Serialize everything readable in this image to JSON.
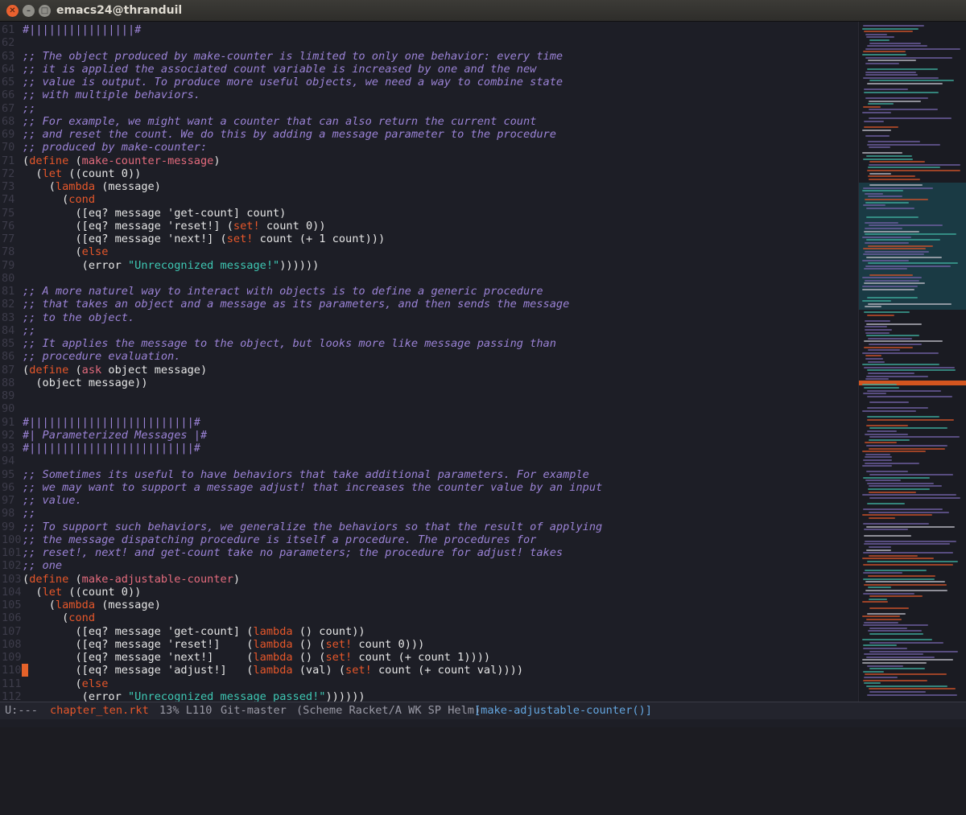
{
  "window": {
    "title": "emacs24@thranduil",
    "buttons": {
      "close": "✕",
      "minimize": "–",
      "maximize": "□"
    }
  },
  "editor": {
    "lines": [
      {
        "n": "61",
        "segs": [
          {
            "t": "#||||||||||||||||#",
            "c": "c"
          }
        ]
      },
      {
        "n": "62",
        "segs": []
      },
      {
        "n": "63",
        "segs": [
          {
            "t": ";; The object produced by make-counter is limited to only one behavior: every time",
            "c": "c"
          }
        ]
      },
      {
        "n": "64",
        "segs": [
          {
            "t": ";; it is applied the associated count variable is increased by one and the new",
            "c": "c"
          }
        ]
      },
      {
        "n": "65",
        "segs": [
          {
            "t": ";; value is output. To produce more useful objects, we need a way to combine state",
            "c": "c"
          }
        ]
      },
      {
        "n": "66",
        "segs": [
          {
            "t": ";; with multiple behaviors.",
            "c": "c"
          }
        ]
      },
      {
        "n": "67",
        "segs": [
          {
            "t": ";;",
            "c": "c"
          }
        ]
      },
      {
        "n": "68",
        "segs": [
          {
            "t": ";; For example, we might want a counter that can also return the current count",
            "c": "c"
          }
        ]
      },
      {
        "n": "69",
        "segs": [
          {
            "t": ";; and reset the count. We do this by adding a message parameter to the procedure",
            "c": "c"
          }
        ]
      },
      {
        "n": "70",
        "segs": [
          {
            "t": ";; produced by make-counter:",
            "c": "c"
          }
        ]
      },
      {
        "n": "71",
        "segs": [
          {
            "t": "(",
            "c": ""
          },
          {
            "t": "define",
            "c": "k"
          },
          {
            "t": " (",
            "c": ""
          },
          {
            "t": "make-counter-message",
            "c": "f"
          },
          {
            "t": ")",
            "c": ""
          }
        ]
      },
      {
        "n": "72",
        "segs": [
          {
            "t": "  (",
            "c": ""
          },
          {
            "t": "let",
            "c": "k"
          },
          {
            "t": " ((count 0))",
            "c": ""
          }
        ]
      },
      {
        "n": "73",
        "segs": [
          {
            "t": "    (",
            "c": ""
          },
          {
            "t": "lambda",
            "c": "k"
          },
          {
            "t": " (message)",
            "c": ""
          }
        ]
      },
      {
        "n": "74",
        "segs": [
          {
            "t": "      (",
            "c": ""
          },
          {
            "t": "cond",
            "c": "k"
          }
        ]
      },
      {
        "n": "75",
        "segs": [
          {
            "t": "        ([eq? message 'get-count] count)",
            "c": ""
          }
        ]
      },
      {
        "n": "76",
        "segs": [
          {
            "t": "        ([eq? message 'reset!] (",
            "c": ""
          },
          {
            "t": "set!",
            "c": "k"
          },
          {
            "t": " count 0))",
            "c": ""
          }
        ]
      },
      {
        "n": "77",
        "segs": [
          {
            "t": "        ([eq? message 'next!] (",
            "c": ""
          },
          {
            "t": "set!",
            "c": "k"
          },
          {
            "t": " count (+ 1 count)))",
            "c": ""
          }
        ]
      },
      {
        "n": "78",
        "segs": [
          {
            "t": "        (",
            "c": ""
          },
          {
            "t": "else",
            "c": "k"
          }
        ]
      },
      {
        "n": "79",
        "segs": [
          {
            "t": "         (error ",
            "c": ""
          },
          {
            "t": "\"Unrecognized message!\"",
            "c": "s"
          },
          {
            "t": "))))))",
            "c": ""
          }
        ]
      },
      {
        "n": "80",
        "segs": []
      },
      {
        "n": "81",
        "segs": [
          {
            "t": ";; A more naturel way to interact with objects is to define a generic procedure",
            "c": "c"
          }
        ]
      },
      {
        "n": "82",
        "segs": [
          {
            "t": ";; that takes an object and a message as its parameters, and then sends the message",
            "c": "c"
          }
        ]
      },
      {
        "n": "83",
        "segs": [
          {
            "t": ";; to the object.",
            "c": "c"
          }
        ]
      },
      {
        "n": "84",
        "segs": [
          {
            "t": ";;",
            "c": "c"
          }
        ]
      },
      {
        "n": "85",
        "segs": [
          {
            "t": ";; It applies the message to the object, but looks more like message passing than",
            "c": "c"
          }
        ]
      },
      {
        "n": "86",
        "segs": [
          {
            "t": ";; procedure evaluation.",
            "c": "c"
          }
        ]
      },
      {
        "n": "87",
        "segs": [
          {
            "t": "(",
            "c": ""
          },
          {
            "t": "define",
            "c": "k"
          },
          {
            "t": " (",
            "c": ""
          },
          {
            "t": "ask",
            "c": "f"
          },
          {
            "t": " object message)",
            "c": ""
          }
        ]
      },
      {
        "n": "88",
        "segs": [
          {
            "t": "  (object message))",
            "c": ""
          }
        ]
      },
      {
        "n": "89",
        "segs": []
      },
      {
        "n": "90",
        "segs": []
      },
      {
        "n": "91",
        "segs": [
          {
            "t": "#|||||||||||||||||||||||||#",
            "c": "c"
          }
        ]
      },
      {
        "n": "92",
        "segs": [
          {
            "t": "#| Parameterized Messages |#",
            "c": "c"
          }
        ]
      },
      {
        "n": "93",
        "segs": [
          {
            "t": "#|||||||||||||||||||||||||#",
            "c": "c"
          }
        ]
      },
      {
        "n": "94",
        "segs": []
      },
      {
        "n": "95",
        "segs": [
          {
            "t": ";; Sometimes its useful to have behaviors that take additional parameters. For example",
            "c": "c"
          }
        ]
      },
      {
        "n": "96",
        "segs": [
          {
            "t": ";; we may want to support a message adjust! that increases the counter value by an input",
            "c": "c"
          }
        ]
      },
      {
        "n": "97",
        "segs": [
          {
            "t": ";; value.",
            "c": "c"
          }
        ]
      },
      {
        "n": "98",
        "segs": [
          {
            "t": ";;",
            "c": "c"
          }
        ]
      },
      {
        "n": "99",
        "segs": [
          {
            "t": ";; To support such behaviors, we generalize the behaviors so that the result of applying",
            "c": "c"
          }
        ]
      },
      {
        "n": "100",
        "segs": [
          {
            "t": ";; the message dispatching procedure is itself a procedure. The procedures for",
            "c": "c"
          }
        ]
      },
      {
        "n": "101",
        "segs": [
          {
            "t": ";; reset!, next! and get-count take no parameters; the procedure for adjust! takes",
            "c": "c"
          }
        ]
      },
      {
        "n": "102",
        "segs": [
          {
            "t": ";; one",
            "c": "c"
          }
        ]
      },
      {
        "n": "103",
        "segs": [
          {
            "t": "(",
            "c": ""
          },
          {
            "t": "define",
            "c": "k"
          },
          {
            "t": " (",
            "c": ""
          },
          {
            "t": "make-adjustable-counter",
            "c": "f"
          },
          {
            "t": ")",
            "c": ""
          }
        ]
      },
      {
        "n": "104",
        "segs": [
          {
            "t": "  (",
            "c": ""
          },
          {
            "t": "let",
            "c": "k"
          },
          {
            "t": " ((count 0))",
            "c": ""
          }
        ]
      },
      {
        "n": "105",
        "segs": [
          {
            "t": "    (",
            "c": ""
          },
          {
            "t": "lambda",
            "c": "k"
          },
          {
            "t": " (message)",
            "c": ""
          }
        ]
      },
      {
        "n": "106",
        "segs": [
          {
            "t": "      (",
            "c": ""
          },
          {
            "t": "cond",
            "c": "k"
          }
        ]
      },
      {
        "n": "107",
        "segs": [
          {
            "t": "        ([eq? message 'get-count] (",
            "c": ""
          },
          {
            "t": "lambda",
            "c": "k"
          },
          {
            "t": " () count))",
            "c": ""
          }
        ]
      },
      {
        "n": "108",
        "segs": [
          {
            "t": "        ([eq? message 'reset!]    (",
            "c": ""
          },
          {
            "t": "lambda",
            "c": "k"
          },
          {
            "t": " () (",
            "c": ""
          },
          {
            "t": "set!",
            "c": "k"
          },
          {
            "t": " count 0)))",
            "c": ""
          }
        ]
      },
      {
        "n": "109",
        "segs": [
          {
            "t": "        ([eq? message 'next!]     (",
            "c": ""
          },
          {
            "t": "lambda",
            "c": "k"
          },
          {
            "t": " () (",
            "c": ""
          },
          {
            "t": "set!",
            "c": "k"
          },
          {
            "t": " count (+ count 1))))",
            "c": ""
          }
        ]
      },
      {
        "n": "110",
        "segs": [
          {
            "t": "        ([eq? message 'adjust!]   (",
            "c": ""
          },
          {
            "t": "lambda",
            "c": "k"
          },
          {
            "t": " (val) (",
            "c": ""
          },
          {
            "t": "set!",
            "c": "k"
          },
          {
            "t": " count (+ count val))))",
            "c": ""
          }
        ]
      },
      {
        "n": "111",
        "segs": [
          {
            "t": "        (",
            "c": ""
          },
          {
            "t": "else",
            "c": "k"
          }
        ]
      },
      {
        "n": "112",
        "segs": [
          {
            "t": "         (error ",
            "c": ""
          },
          {
            "t": "\"Unrecognized message passed!\"",
            "c": "s"
          },
          {
            "t": "))))))",
            "c": ""
          }
        ]
      }
    ],
    "cursor_line": "110"
  },
  "modeline": {
    "state": "U:---",
    "filename": "chapter_ten.rkt",
    "position": "13% L110",
    "vc": "Git-master",
    "modes": "(Scheme Racket/A WK SP Helm)",
    "function": "[make-adjustable-counter()]"
  },
  "colors": {
    "background": "#1d1e26",
    "comment": "#9b83d6",
    "keyword": "#e7572a",
    "function_name": "#e46b7d",
    "string": "#3ec8b4",
    "cursor": "#e5622a"
  }
}
